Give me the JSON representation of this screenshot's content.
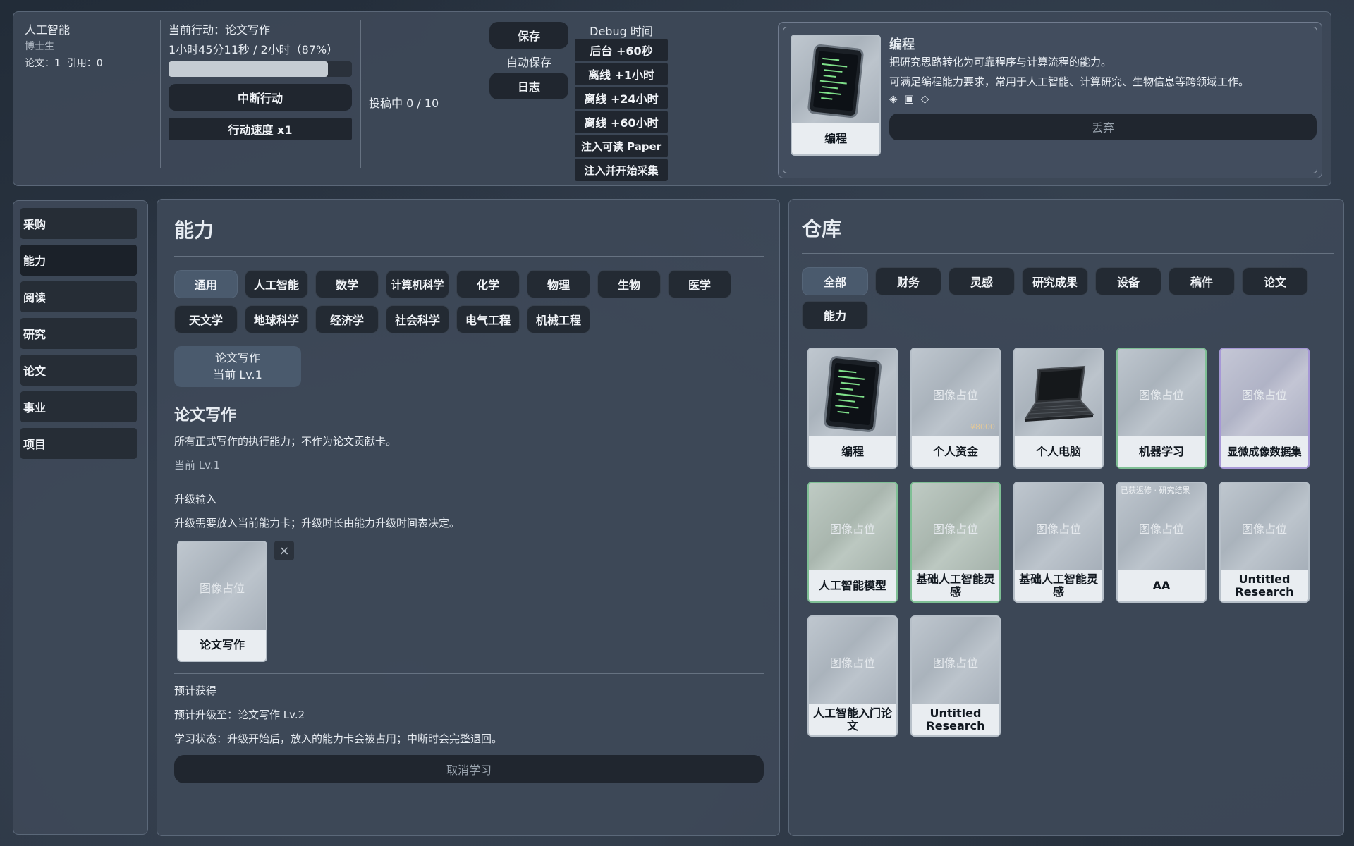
{
  "profile": {
    "name": "人工智能",
    "degree": "博士生",
    "stats": "论文：1  引用：0"
  },
  "action": {
    "current": "当前行动：论文写作",
    "time": "1小时45分11秒 / 2小时（87%）",
    "progress": 0.87,
    "interrupt": "中断行动",
    "speed": "行动速度 x1"
  },
  "submission": "投稿中 0 / 10",
  "system": {
    "save": "保存",
    "autosave": "自动保存",
    "log": "日志"
  },
  "debug": {
    "title": "Debug 时间",
    "buttons": [
      "后台 +60秒",
      "离线 +1小时",
      "离线 +24小时",
      "离线 +60小时",
      "注入可读 Paper",
      "注入并开始采集"
    ]
  },
  "detail": {
    "title": "编程",
    "desc1": "把研究思路转化为可靠程序与计算流程的能力。",
    "desc2": "可满足编程能力要求，常用于人工智能、计算研究、生物信息等跨领域工作。",
    "icons": "◈  ▣  ◇",
    "card_label": "编程",
    "discard": "丢弃"
  },
  "nav": {
    "items": [
      "采购",
      "能力",
      "阅读",
      "研究",
      "论文",
      "事业",
      "项目"
    ],
    "active_index": 1
  },
  "ability": {
    "title": "能力",
    "tabs_row1": [
      "通用",
      "人工智能",
      "数学",
      "计算机科学",
      "化学",
      "物理",
      "生物",
      "医学"
    ],
    "tabs_row2": [
      "天文学",
      "地球科学",
      "经济学",
      "社会科学",
      "电气工程",
      "机械工程"
    ],
    "active_tab": "通用",
    "skill_card": {
      "name": "论文写作",
      "level": "当前 Lv.1"
    },
    "section_title": "论文写作",
    "section_desc": "所有正式写作的执行能力；不作为论文贡献卡。",
    "section_level": "当前 Lv.1",
    "upgrade_title": "升级输入",
    "upgrade_desc": "升级需要放入当前能力卡；升级时长由能力升级时间表决定。",
    "slot_card": {
      "placeholder": "图像占位",
      "label": "论文写作"
    },
    "remove_icon": "×",
    "expect_title": "预计获得",
    "expect_level": "预计升级至：论文写作 Lv.2",
    "study_status": "学习状态：升级开始后，放入的能力卡会被占用；中断时会完整退回。",
    "cancel": "取消学习"
  },
  "warehouse": {
    "title": "仓库",
    "tabs": [
      "全部",
      "财务",
      "灵感",
      "研究成果",
      "设备",
      "稿件",
      "论文",
      "能力"
    ],
    "active_tab": "全部",
    "cards": [
      {
        "label": "编程",
        "art": "code-tablet",
        "border": "default"
      },
      {
        "label": "个人资金",
        "art": "placeholder",
        "placeholder": "图像占位",
        "tag": "¥8000",
        "border": "default"
      },
      {
        "label": "个人电脑",
        "art": "laptop",
        "border": "default"
      },
      {
        "label": "机器学习",
        "art": "placeholder",
        "placeholder": "图像占位",
        "border": "green"
      },
      {
        "label": "显微成像数据集",
        "art": "placeholder",
        "placeholder": "图像占位",
        "border": "purple"
      },
      {
        "label": "人工智能模型",
        "art": "placeholder",
        "placeholder": "图像占位",
        "border": "green"
      },
      {
        "label": "基础人工智能灵感",
        "art": "placeholder",
        "placeholder": "图像占位",
        "border": "green"
      },
      {
        "label": "基础人工智能灵感",
        "art": "placeholder",
        "placeholder": "图像占位",
        "border": "default"
      },
      {
        "label": "AA",
        "art": "placeholder",
        "placeholder": "图像占位",
        "topnote": "已获返修 · 研究结果",
        "border": "default"
      },
      {
        "label": "Untitled Research",
        "art": "placeholder",
        "placeholder": "图像占位",
        "border": "default"
      },
      {
        "label": "人工智能入门论文",
        "art": "placeholder",
        "placeholder": "图像占位",
        "border": "default"
      },
      {
        "label": "Untitled Research",
        "art": "placeholder",
        "placeholder": "图像占位",
        "border": "default"
      }
    ]
  },
  "colors": {
    "panel": "#3e4958",
    "button": "#20262f",
    "active_tab": "#4a5a6d",
    "card_label": "#e9edf1",
    "green_border": "#7fbf95",
    "purple_border": "#a698d6"
  }
}
